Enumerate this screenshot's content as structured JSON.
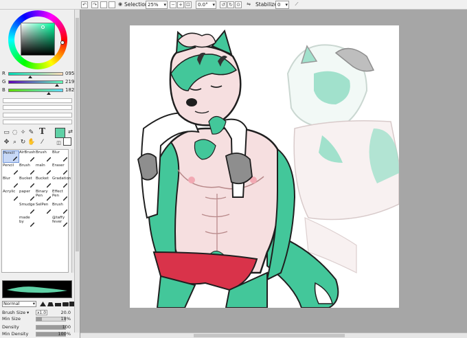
{
  "toolbar": {
    "selection_label": "Selection",
    "zoom_value": "25%",
    "rotation_value": "0.0°",
    "stabilizer_label": "Stabilizer",
    "stabilizer_value": "0"
  },
  "color": {
    "r_label": "R",
    "r_value": "095",
    "g_label": "G",
    "g_value": "219",
    "b_label": "B",
    "b_value": "182",
    "r_fraction": 0.37,
    "g_fraction": 0.86,
    "b_fraction": 0.71,
    "current_color": "#5fdbb6"
  },
  "tools": [
    {
      "label": "Pencil",
      "icon": "pencil-icon",
      "selected": true
    },
    {
      "label": "AirBrush",
      "icon": "airbrush-icon",
      "selected": false
    },
    {
      "label": "Brush",
      "icon": "brush-icon",
      "selected": false
    },
    {
      "label": "Blur",
      "icon": "blur-icon",
      "selected": false
    },
    {
      "label": "Pencil",
      "icon": "pencil-icon",
      "selected": false
    },
    {
      "label": "Brush",
      "icon": "brush-icon",
      "selected": false
    },
    {
      "label": "maîn",
      "icon": "brush-icon",
      "selected": false
    },
    {
      "label": "Eraser",
      "icon": "eraser-icon",
      "selected": false
    },
    {
      "label": "Blur",
      "icon": "blur-icon",
      "selected": false
    },
    {
      "label": "Bucket",
      "icon": "bucket-icon",
      "selected": false
    },
    {
      "label": "Bucket",
      "icon": "bucket-icon",
      "selected": false
    },
    {
      "label": "Gradation",
      "icon": "gradation-icon",
      "selected": false
    },
    {
      "label": "Acrylic",
      "icon": "brush-icon",
      "selected": false
    },
    {
      "label": "paper",
      "icon": "brush-icon",
      "selected": false
    },
    {
      "label": "Binary Pen",
      "icon": "pen-icon",
      "selected": false
    },
    {
      "label": "Effect Pen",
      "icon": "pen-icon",
      "selected": false
    },
    {
      "label": "",
      "icon": "",
      "selected": false
    },
    {
      "label": "Smudge",
      "icon": "smudge-icon",
      "selected": false
    },
    {
      "label": "SelPen",
      "icon": "selpen-icon",
      "selected": false
    },
    {
      "label": "Brush",
      "icon": "brush-icon",
      "selected": false
    },
    {
      "label": "",
      "icon": "",
      "selected": false
    },
    {
      "label": "made by",
      "icon": "brush-icon",
      "selected": false
    },
    {
      "label": "",
      "icon": "",
      "selected": false
    },
    {
      "label": "@taffy fever",
      "icon": "brush-icon",
      "selected": false
    }
  ],
  "brush": {
    "blend_mode": "Normal",
    "size_label": "Brush Size",
    "size_multiplier": "x1.0",
    "size_value": "20.0",
    "min_size_label": "Min Size",
    "min_size_value": "18%",
    "min_size_fraction": 0.18,
    "density_label": "Density",
    "density_value": "100",
    "density_fraction": 1.0,
    "min_density_label": "Min Density",
    "min_density_value": "100%",
    "min_density_fraction": 1.0
  }
}
